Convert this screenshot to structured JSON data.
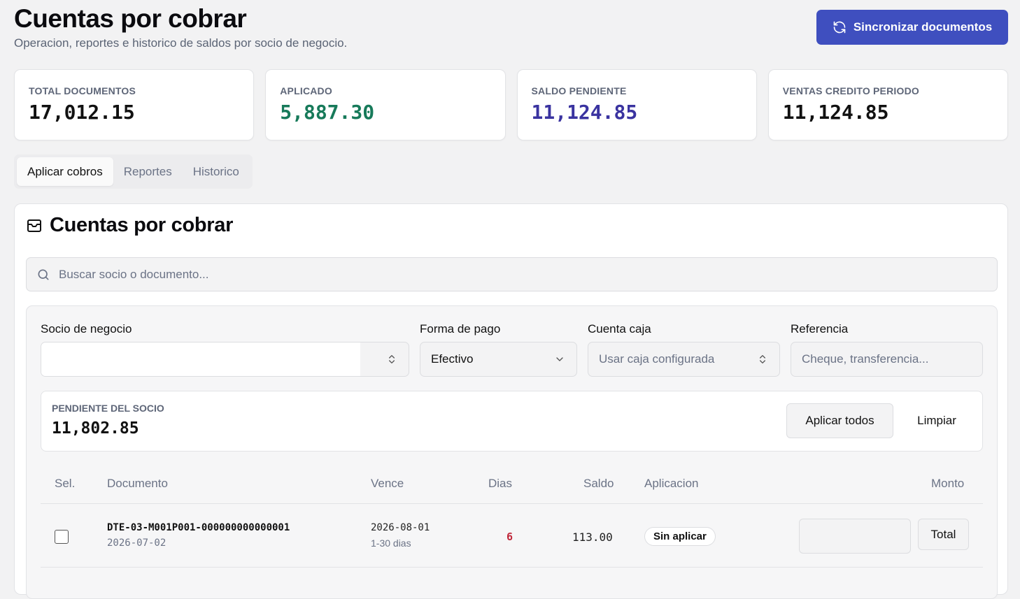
{
  "header": {
    "title": "Cuentas por cobrar",
    "subtitle": "Operacion, reportes e historico de saldos por socio de negocio.",
    "sync_label": "Sincronizar documentos"
  },
  "stats": [
    {
      "label": "TOTAL DOCUMENTOS",
      "value": "17,012.15",
      "color": "#111111"
    },
    {
      "label": "APLICADO",
      "value": "5,887.30",
      "color": "#177a5a"
    },
    {
      "label": "SALDO PENDIENTE",
      "value": "11,124.85",
      "color": "#3a33a0"
    },
    {
      "label": "VENTAS CREDITO PERIODO",
      "value": "11,124.85",
      "color": "#111111"
    }
  ],
  "tabs": [
    "Aplicar cobros",
    "Reportes",
    "Historico"
  ],
  "card": {
    "title": "Cuentas por cobrar",
    "search_placeholder": "Buscar socio o documento..."
  },
  "form": {
    "socio_label": "Socio de negocio",
    "forma_pago_label": "Forma de pago",
    "forma_pago_value": "Efectivo",
    "cuenta_caja_label": "Cuenta caja",
    "cuenta_caja_placeholder": "Usar caja configurada",
    "referencia_label": "Referencia",
    "referencia_placeholder": "Cheque, transferencia..."
  },
  "pending": {
    "label": "PENDIENTE DEL SOCIO",
    "value": "11,802.85",
    "apply_all_label": "Aplicar todos",
    "clear_label": "Limpiar"
  },
  "table": {
    "headers": {
      "sel": "Sel.",
      "documento": "Documento",
      "vence": "Vence",
      "dias": "Dias",
      "saldo": "Saldo",
      "aplicacion": "Aplicacion",
      "monto": "Monto"
    },
    "rows": [
      {
        "documento": "DTE-03-M001P001-000000000000001",
        "fecha": "2026-07-02",
        "vence": "2026-08-01",
        "rango": "1-30 dias",
        "dias": "6",
        "saldo": "113.00",
        "aplicacion": "Sin aplicar",
        "total_label": "Total"
      }
    ]
  }
}
